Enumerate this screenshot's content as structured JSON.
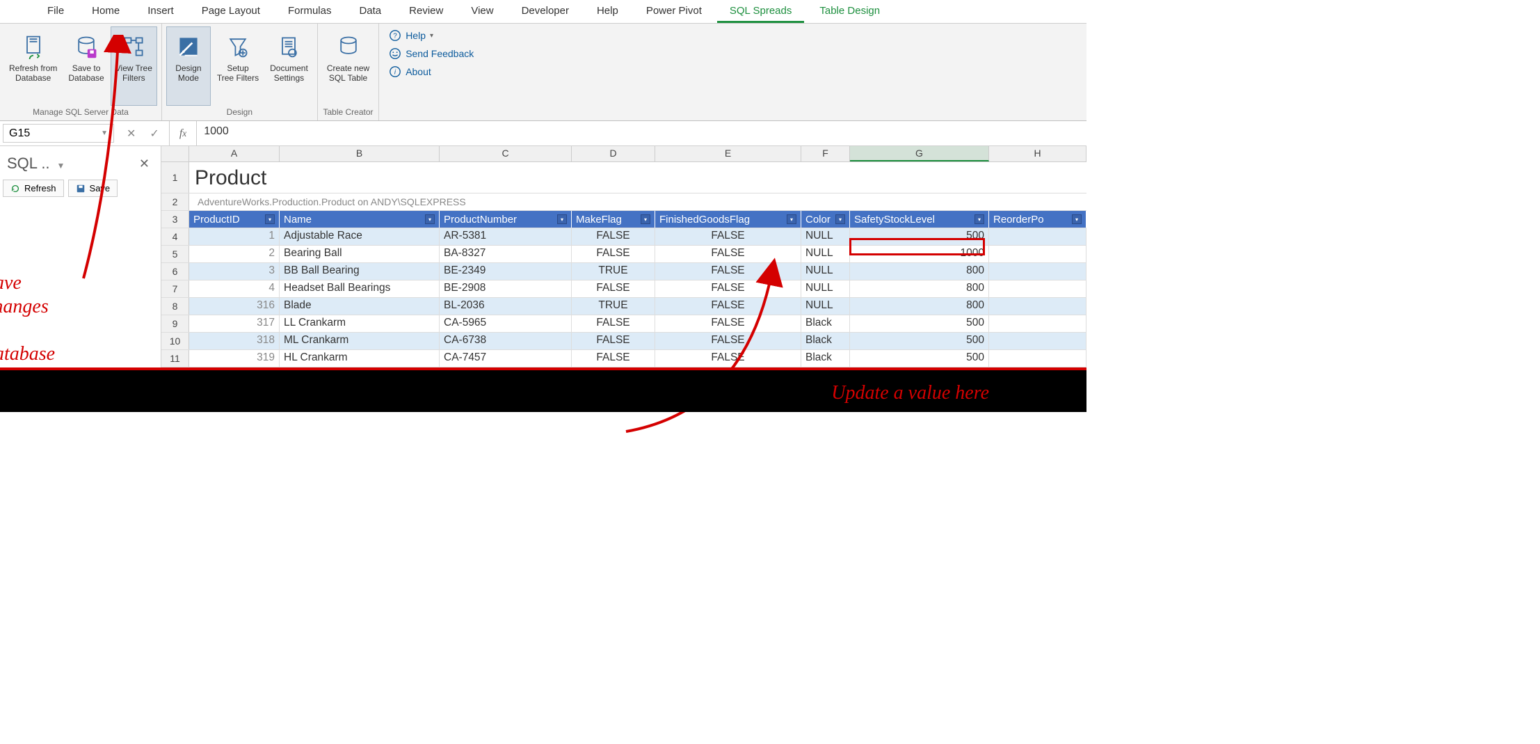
{
  "ribbon": {
    "tabs": [
      "File",
      "Home",
      "Insert",
      "Page Layout",
      "Formulas",
      "Data",
      "Review",
      "View",
      "Developer",
      "Help",
      "Power Pivot",
      "SQL Spreads",
      "Table Design"
    ],
    "active_tab": "SQL Spreads",
    "groups": [
      {
        "label": "Manage SQL Server Data",
        "buttons": [
          {
            "key": "refresh_db",
            "label": "Refresh from\nDatabase"
          },
          {
            "key": "save_db",
            "label": "Save to\nDatabase"
          },
          {
            "key": "view_tree",
            "label": "View Tree\nFilters",
            "selected": true
          }
        ]
      },
      {
        "label": "Design",
        "buttons": [
          {
            "key": "design_mode",
            "label": "Design\nMode",
            "selected": true
          },
          {
            "key": "setup_tree",
            "label": "Setup\nTree Filters"
          },
          {
            "key": "doc_settings",
            "label": "Document\nSettings"
          }
        ]
      },
      {
        "label": "Table Creator",
        "buttons": [
          {
            "key": "create_table",
            "label": "Create new\nSQL Table"
          }
        ]
      }
    ],
    "misc": [
      {
        "key": "help",
        "label": "Help",
        "dd": true
      },
      {
        "key": "feedback",
        "label": "Send Feedback"
      },
      {
        "key": "about",
        "label": "About"
      }
    ]
  },
  "formula_bar": {
    "name_box": "G15",
    "value": "1000"
  },
  "side_panel": {
    "title": "SQL ..",
    "buttons": [
      "Refresh",
      "Save"
    ]
  },
  "sheet": {
    "columns": [
      "A",
      "B",
      "C",
      "D",
      "E",
      "F",
      "G",
      "H"
    ],
    "title": "Product",
    "subtitle": "AdventureWorks.Production.Product on ANDY\\SQLEXPRESS",
    "headers": [
      "ProductID",
      "Name",
      "ProductNumber",
      "MakeFlag",
      "FinishedGoodsFlag",
      "Color",
      "SafetyStockLevel",
      "ReorderPo"
    ],
    "rows": [
      {
        "n": 4,
        "ProductID": "1",
        "Name": "Adjustable Race",
        "ProductNumber": "AR-5381",
        "MakeFlag": "FALSE",
        "FinishedGoodsFlag": "FALSE",
        "Color": "NULL",
        "SafetyStockLevel": "500"
      },
      {
        "n": 5,
        "ProductID": "2",
        "Name": "Bearing Ball",
        "ProductNumber": "BA-8327",
        "MakeFlag": "FALSE",
        "FinishedGoodsFlag": "FALSE",
        "Color": "NULL",
        "SafetyStockLevel": "1000"
      },
      {
        "n": 6,
        "ProductID": "3",
        "Name": "BB Ball Bearing",
        "ProductNumber": "BE-2349",
        "MakeFlag": "TRUE",
        "FinishedGoodsFlag": "FALSE",
        "Color": "NULL",
        "SafetyStockLevel": "800"
      },
      {
        "n": 7,
        "ProductID": "4",
        "Name": "Headset Ball Bearings",
        "ProductNumber": "BE-2908",
        "MakeFlag": "FALSE",
        "FinishedGoodsFlag": "FALSE",
        "Color": "NULL",
        "SafetyStockLevel": "800"
      },
      {
        "n": 8,
        "ProductID": "316",
        "Name": "Blade",
        "ProductNumber": "BL-2036",
        "MakeFlag": "TRUE",
        "FinishedGoodsFlag": "FALSE",
        "Color": "NULL",
        "SafetyStockLevel": "800"
      },
      {
        "n": 9,
        "ProductID": "317",
        "Name": "LL Crankarm",
        "ProductNumber": "CA-5965",
        "MakeFlag": "FALSE",
        "FinishedGoodsFlag": "FALSE",
        "Color": "Black",
        "SafetyStockLevel": "500"
      },
      {
        "n": 10,
        "ProductID": "318",
        "Name": "ML Crankarm",
        "ProductNumber": "CA-6738",
        "MakeFlag": "FALSE",
        "FinishedGoodsFlag": "FALSE",
        "Color": "Black",
        "SafetyStockLevel": "500"
      },
      {
        "n": 11,
        "ProductID": "319",
        "Name": "HL Crankarm",
        "ProductNumber": "CA-7457",
        "MakeFlag": "FALSE",
        "FinishedGoodsFlag": "FALSE",
        "Color": "Black",
        "SafetyStockLevel": "500"
      }
    ]
  },
  "annotations": {
    "left": "Save\nchanges\nto\ndatabase",
    "bottom": "Update a value here"
  }
}
